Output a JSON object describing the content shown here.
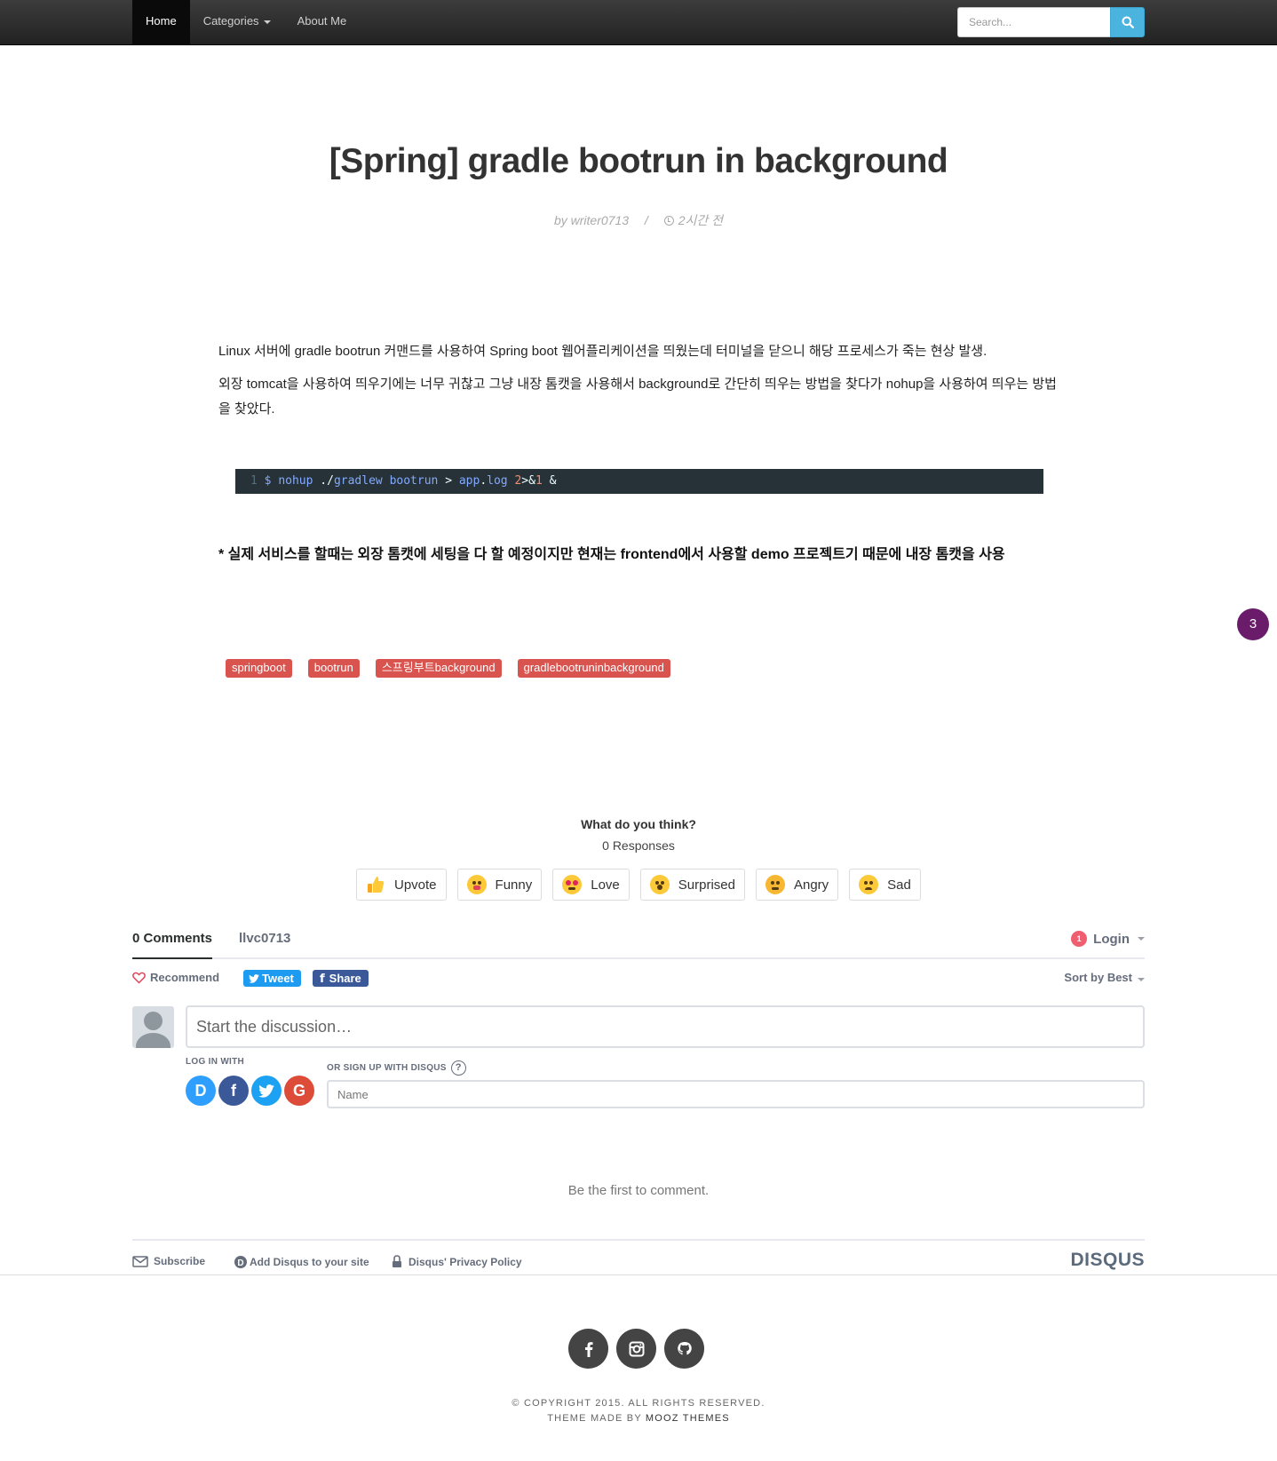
{
  "nav": {
    "items": [
      {
        "label": "Home",
        "active": true
      },
      {
        "label": "Categories",
        "dropdown": true
      },
      {
        "label": "About Me"
      }
    ],
    "search": {
      "placeholder": "Search...",
      "icon": "search-icon"
    }
  },
  "post": {
    "title": "[Spring] gradle bootrun in background",
    "author": "by writer0713",
    "meta_separator": "/",
    "time": "2시간 전",
    "paragraphs": [
      "Linux 서버에 gradle bootrun 커맨드를 사용하여 Spring boot 웹어플리케이션을 띄웠는데 터미널을 닫으니 해당 프로세스가 죽는 현상 발생.",
      "외장 tomcat을 사용하여 띄우기에는 너무 귀찮고 그냥 내장 톰캣을 사용해서 background로 간단히 띄우는 방법을 찾다가 nohup을 사용하여 띄우는 방법을 찾았다."
    ],
    "code": {
      "line_number": "1",
      "tokens": [
        "$",
        "nohup",
        "./",
        "gradlew",
        "bootrun",
        ">",
        "app",
        ".",
        "log",
        "2",
        ">&",
        "1",
        "&"
      ]
    },
    "note": "* 실제 서비스를 할때는 외장 톰캣에 세팅을 다 할 예정이지만 현재는 frontend에서 사용할 demo 프로젝트기 때문에 내장 톰캣을 사용",
    "floating_count": "3",
    "tags": [
      "springboot",
      "bootrun",
      "스프링부트background",
      "gradlebootruninbackground"
    ]
  },
  "reactions": {
    "title": "What do you think?",
    "responses": "0 Responses",
    "items": [
      {
        "label": "Upvote",
        "icon": "thumbs-up-icon"
      },
      {
        "label": "Funny",
        "icon": "tongue-face-icon"
      },
      {
        "label": "Love",
        "icon": "heart-eyes-icon"
      },
      {
        "label": "Surprised",
        "icon": "surprised-face-icon"
      },
      {
        "label": "Angry",
        "icon": "angry-face-icon"
      },
      {
        "label": "Sad",
        "icon": "sad-face-icon"
      }
    ]
  },
  "comments": {
    "tab_comments": "0 Comments",
    "tab_site": "llvc0713",
    "login_badge": "1",
    "login": "Login",
    "recommend": "Recommend",
    "tweet": "Tweet",
    "share": "Share",
    "sort": "Sort by Best",
    "discussion_placeholder": "Start the discussion…",
    "log_in_with": "LOG IN WITH",
    "sign_up_with": "OR SIGN UP WITH DISQUS",
    "help": "?",
    "name_placeholder": "Name",
    "social_logins": [
      {
        "letter": "D",
        "icon": "disqus-icon",
        "color": "#2e9fff"
      },
      {
        "letter": "f",
        "icon": "facebook-icon",
        "color": "#3b5998"
      },
      {
        "letter": "t",
        "icon": "twitter-icon",
        "color": "#1da1f2"
      },
      {
        "letter": "G",
        "icon": "google-icon",
        "color": "#dd4b39"
      }
    ],
    "empty": "Be the first to comment.",
    "footer": {
      "subscribe": "Subscribe",
      "add_disqus": "Add Disqus to your site",
      "privacy": "Disqus' Privacy Policy",
      "brand": "DISQUS"
    }
  },
  "footer": {
    "social": [
      "facebook-icon",
      "instagram-icon",
      "github-icon"
    ],
    "copyright": "© COPYRIGHT 2015. ALL RIGHTS RESERVED.",
    "theme_prefix": "THEME MADE BY",
    "theme_author": "MOOZ THEMES"
  },
  "colors": {
    "tag": "#d9534f",
    "code_bg": "#263238",
    "search_button": "#4ab3de",
    "floating_badge": "#6a1b6a"
  }
}
